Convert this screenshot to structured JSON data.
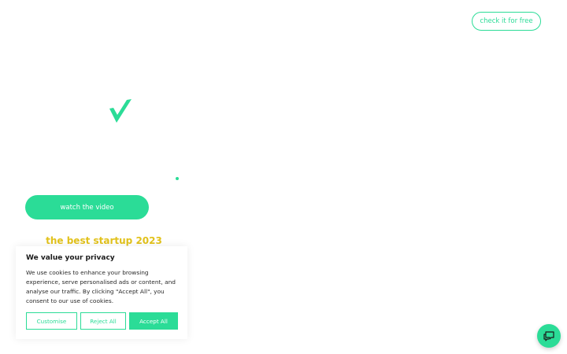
{
  "header": {
    "cta_label": "check it for free"
  },
  "hero": {
    "video_button_label": "watch the video",
    "tagline": "the best startup 2023"
  },
  "cookie_banner": {
    "title": "We value your privacy",
    "body": "We use cookies to enhance your browsing experience, serve personalised ads or content, and analyse our traffic. By clicking \"Accept All\", you consent to our use of cookies.",
    "customise_label": "Customise",
    "reject_label": "Reject All",
    "accept_label": "Accept All"
  },
  "icons": {
    "logo": "check-mark-icon",
    "chat": "chat-bubbles-icon"
  },
  "colors": {
    "accent": "#2bdc97",
    "tagline": "#e2c21c",
    "text": "#1a1a1a"
  }
}
